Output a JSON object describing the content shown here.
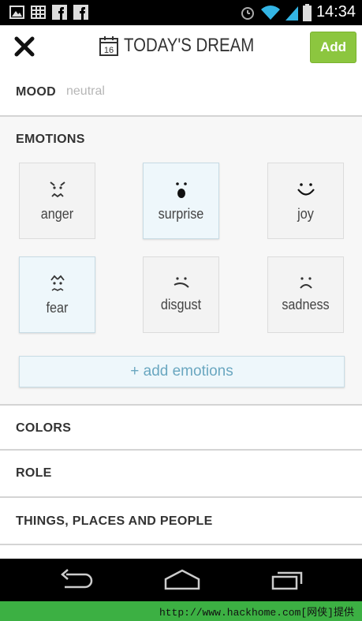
{
  "status_bar": {
    "time": "14:34",
    "left_icons": [
      "image-icon",
      "grid-icon",
      "facebook-icon",
      "facebook-icon"
    ],
    "right_icons": [
      "alarm-icon",
      "wifi-icon",
      "signal-icon",
      "battery-icon"
    ]
  },
  "app_bar": {
    "title": "TODAY'S DREAM",
    "calendar_day": "16",
    "add_label": "Add",
    "close_icon": "close-icon"
  },
  "mood": {
    "label": "MOOD",
    "value": "neutral"
  },
  "emotions": {
    "label": "EMOTIONS",
    "items": [
      {
        "label": "anger",
        "icon": "anger-face-icon",
        "selected": false
      },
      {
        "label": "surprise",
        "icon": "surprise-face-icon",
        "selected": true
      },
      {
        "label": "joy",
        "icon": "joy-face-icon",
        "selected": false
      },
      {
        "label": "fear",
        "icon": "fear-face-icon",
        "selected": true
      },
      {
        "label": "disgust",
        "icon": "disgust-face-icon",
        "selected": false
      },
      {
        "label": "sadness",
        "icon": "sadness-face-icon",
        "selected": false
      }
    ],
    "add_label": "+ add emotions"
  },
  "sections": {
    "colors": "COLORS",
    "role": "ROLE",
    "things": "THINGS, PLACES AND PEOPLE"
  },
  "nav_bar": {
    "icons": [
      "back-icon",
      "home-icon",
      "recent-apps-icon"
    ]
  },
  "watermark": "http://www.hackhome.com[网侠]提供",
  "colors": {
    "accent_green": "#8cc63f",
    "selected_tile": "#eef7fb",
    "add_emotions_text": "#6aa7c0"
  }
}
